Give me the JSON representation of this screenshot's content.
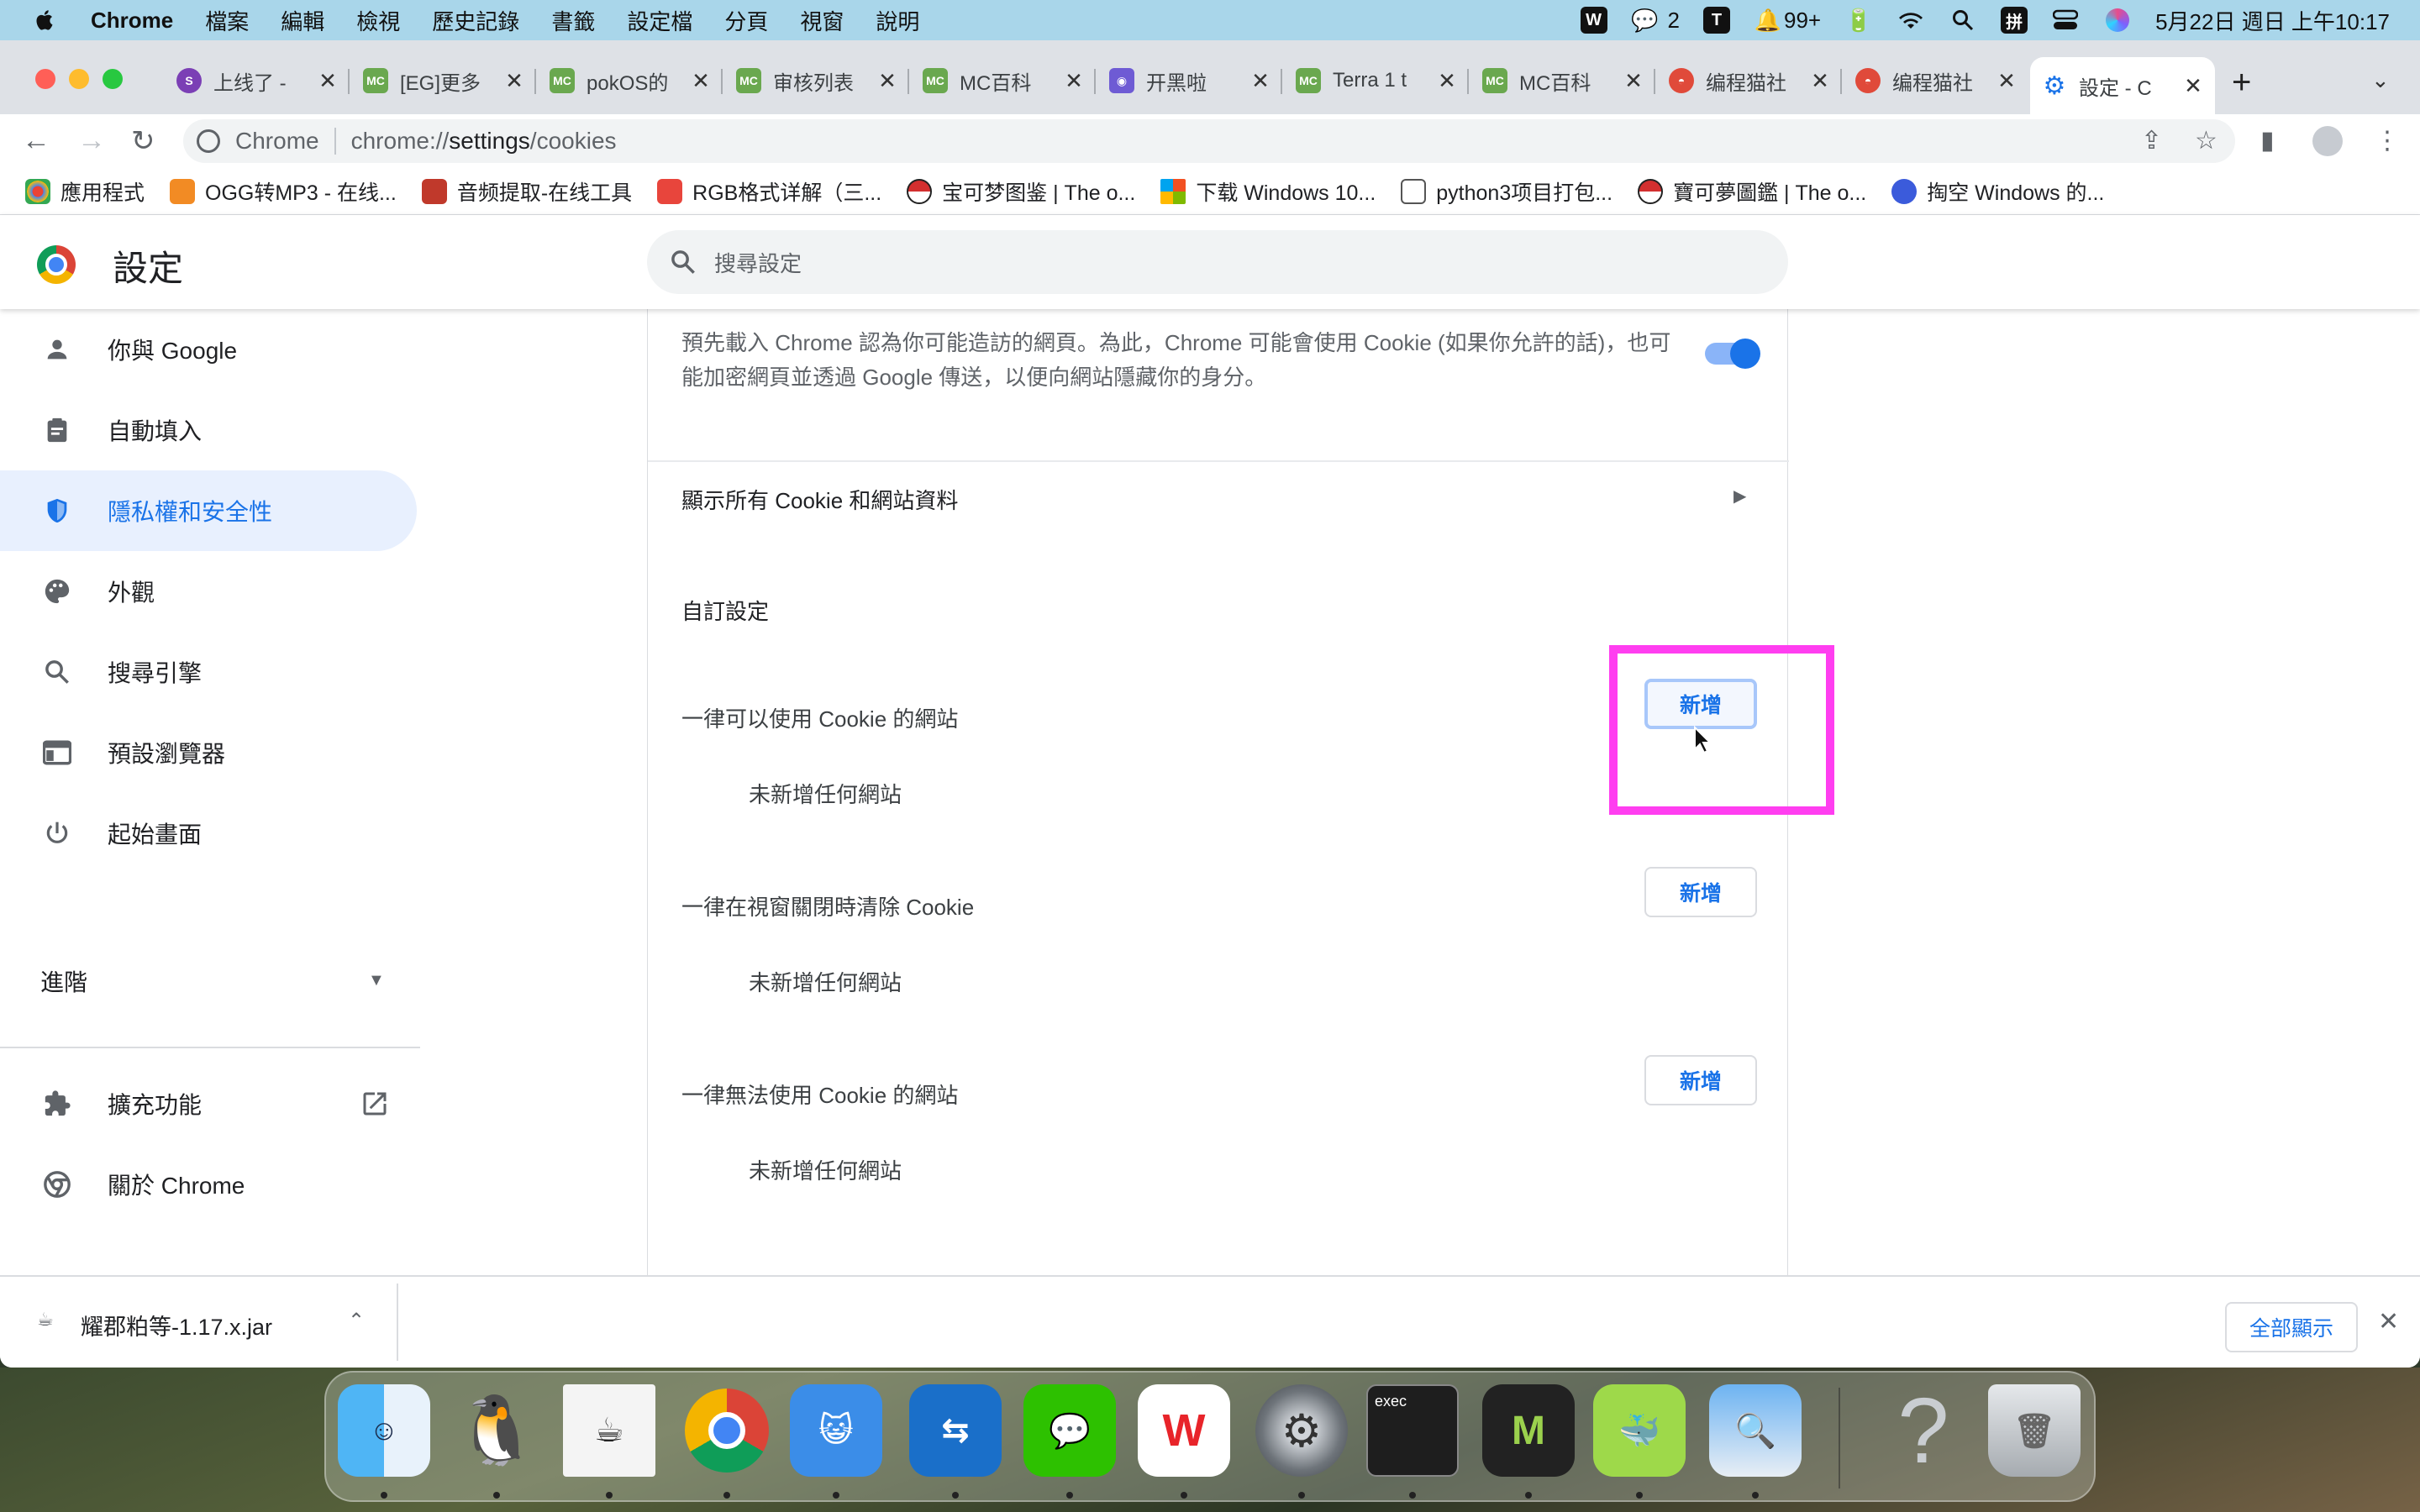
{
  "menubar": {
    "app_name": "Chrome",
    "menus": [
      "檔案",
      "編輯",
      "檢視",
      "歷史記錄",
      "書籤",
      "設定檔",
      "分頁",
      "視窗",
      "說明"
    ],
    "wechat_count": "2",
    "notification_count": "99+",
    "datetime": "5月22日 週日 上午10:17",
    "status_icons": [
      "wps-icon",
      "wechat-icon",
      "typora-icon",
      "bell-icon",
      "battery-icon",
      "wifi-icon",
      "spotlight-icon",
      "input-method-icon",
      "control-center-icon",
      "siri-icon"
    ]
  },
  "tabs": [
    {
      "title": "上线了 -",
      "icon": "s-logo",
      "color": "#7b3fb5"
    },
    {
      "title": "[EG]更多",
      "icon": "mc-logo",
      "color": "#6aa84f"
    },
    {
      "title": "pokOS的",
      "icon": "mc-logo",
      "color": "#6aa84f"
    },
    {
      "title": "审核列表",
      "icon": "mc-logo",
      "color": "#6aa84f"
    },
    {
      "title": "MC百科",
      "icon": "mc-logo",
      "color": "#6aa84f"
    },
    {
      "title": "开黑啦",
      "icon": "kook-logo",
      "color": "#6e5bd4"
    },
    {
      "title": "Terra 1 t",
      "icon": "mc-logo",
      "color": "#6aa84f"
    },
    {
      "title": "MC百科",
      "icon": "mc-logo",
      "color": "#6aa84f"
    },
    {
      "title": "编程猫社",
      "icon": "codemao-logo",
      "color": "#e04a3a"
    },
    {
      "title": "编程猫社",
      "icon": "codemao-logo",
      "color": "#e04a3a"
    },
    {
      "title": "設定 - C",
      "icon": "gear-logo",
      "color": "#1a73e8",
      "active": true
    }
  ],
  "omnibox": {
    "site_name": "Chrome",
    "url_prefix": "chrome://",
    "url_main": "settings",
    "url_path": "/cookies"
  },
  "bookmarks": [
    {
      "label": "應用程式",
      "color": "#ea4335"
    },
    {
      "label": "OGG转MP3 - 在线...",
      "color": "#f28b24"
    },
    {
      "label": "音频提取-在线工具",
      "color": "#c0392b"
    },
    {
      "label": "RGB格式详解（三...",
      "color": "#e8453c"
    },
    {
      "label": "宝可梦图鉴 | The o...",
      "color": "#d32f2f"
    },
    {
      "label": "下载 Windows 10...",
      "color": "#2ea043"
    },
    {
      "label": "python3项目打包...",
      "color": "#555555"
    },
    {
      "label": "寶可夢圖鑑 | The o...",
      "color": "#d32f2f"
    },
    {
      "label": "掏空 Windows 的...",
      "color": "#3b5bdb"
    }
  ],
  "settings": {
    "title": "設定",
    "search_placeholder": "搜尋設定"
  },
  "sidebar": {
    "items": [
      {
        "label": "你與 Google",
        "icon": "person-icon"
      },
      {
        "label": "自動填入",
        "icon": "clipboard-icon"
      },
      {
        "label": "隱私權和安全性",
        "icon": "shield-icon",
        "active": true
      },
      {
        "label": "外觀",
        "icon": "palette-icon"
      },
      {
        "label": "搜尋引擎",
        "icon": "search-icon"
      },
      {
        "label": "預設瀏覽器",
        "icon": "browser-icon"
      },
      {
        "label": "起始畫面",
        "icon": "power-icon"
      }
    ],
    "advanced_label": "進階",
    "extensions_label": "擴充功能",
    "about_label": "關於 Chrome"
  },
  "content": {
    "preload_description": "預先載入 Chrome 認為你可能造訪的網頁。為此，Chrome 可能會使用 Cookie (如果你允許的話)，也可能加密網頁並透過 Google 傳送，以便向網站隱藏你的身分。",
    "preload_enabled": true,
    "show_all_cookies": "顯示所有 Cookie 和網站資料",
    "custom_section": "自訂設定",
    "groups": [
      {
        "label": "一律可以使用 Cookie 的網站",
        "empty": "未新增任何網站",
        "button": "新增"
      },
      {
        "label": "一律在視窗關閉時清除 Cookie",
        "empty": "未新增任何網站",
        "button": "新增"
      },
      {
        "label": "一律無法使用 Cookie 的網站",
        "empty": "未新增任何網站",
        "button": "新增"
      }
    ],
    "highlight_color": "#ff3ef0"
  },
  "download_bar": {
    "filename": "耀郡粕等-1.17.x.jar",
    "show_all": "全部顯示"
  },
  "dock": {
    "apps": [
      "finder-icon",
      "qq-icon",
      "java-icon",
      "chrome-icon",
      "codemao-icon",
      "teamviewer-icon",
      "wechat-icon",
      "wps-icon",
      "system-preferences-icon",
      "terminal-icon",
      "mcreator-icon",
      "narwhal-icon",
      "preview-icon",
      "unknown-app-icon",
      "trash-icon"
    ],
    "terminal_text": "exec"
  }
}
